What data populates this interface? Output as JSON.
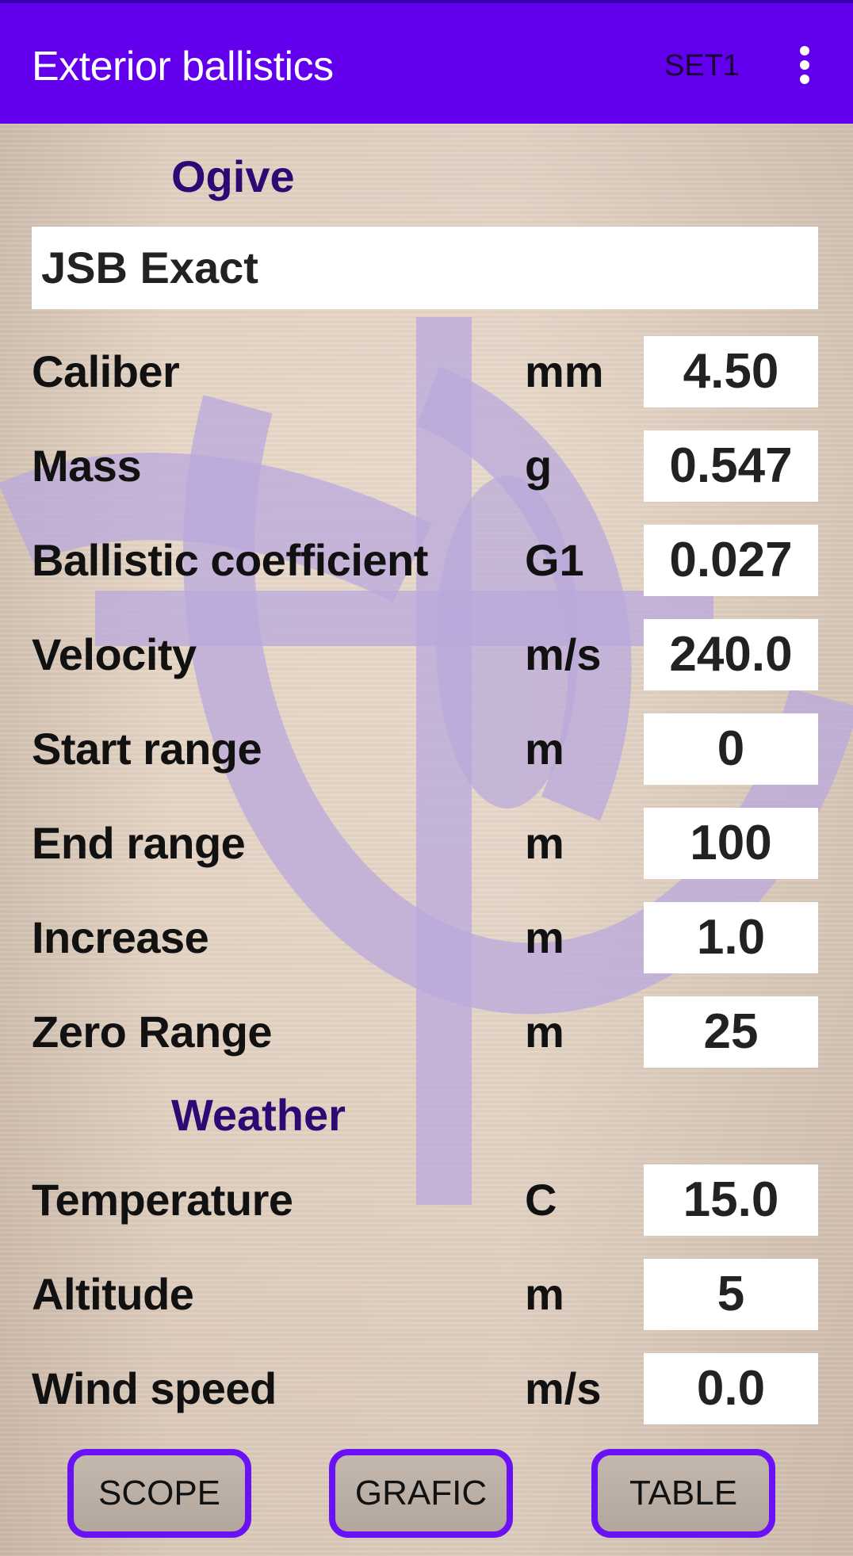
{
  "app_bar": {
    "title": "Exterior ballistics",
    "set_label": "SET1",
    "menu_icon": "more-vert-icon"
  },
  "colors": {
    "primary": "#6200ee",
    "section_title": "#2a0a73",
    "button_border": "#6a11f5"
  },
  "ogive": {
    "section_title": "Ogive",
    "name_value": "JSB Exact"
  },
  "ogive_fields": [
    {
      "label": "Caliber",
      "unit": "mm",
      "value": "4.50"
    },
    {
      "label": "Mass",
      "unit": "g",
      "value": "0.547"
    },
    {
      "label": "Ballistic coefficient",
      "unit": "G1",
      "value": "0.027"
    },
    {
      "label": "Velocity",
      "unit": "m/s",
      "value": "240.0"
    },
    {
      "label": "Start range",
      "unit": "m",
      "value": "0"
    },
    {
      "label": "End range",
      "unit": "m",
      "value": "100"
    },
    {
      "label": "Increase",
      "unit": "m",
      "value": "1.0"
    },
    {
      "label": "Zero Range",
      "unit": "m",
      "value": "25"
    }
  ],
  "weather": {
    "section_title": "Weather"
  },
  "weather_fields": [
    {
      "label": "Temperature",
      "unit": "C",
      "value": "15.0"
    },
    {
      "label": "Altitude",
      "unit": "m",
      "value": "5"
    },
    {
      "label": "Wind speed",
      "unit": "m/s",
      "value": "0.0"
    }
  ],
  "buttons": {
    "scope": "SCOPE",
    "grafic": "GRAFIC",
    "table": "TABLE"
  }
}
